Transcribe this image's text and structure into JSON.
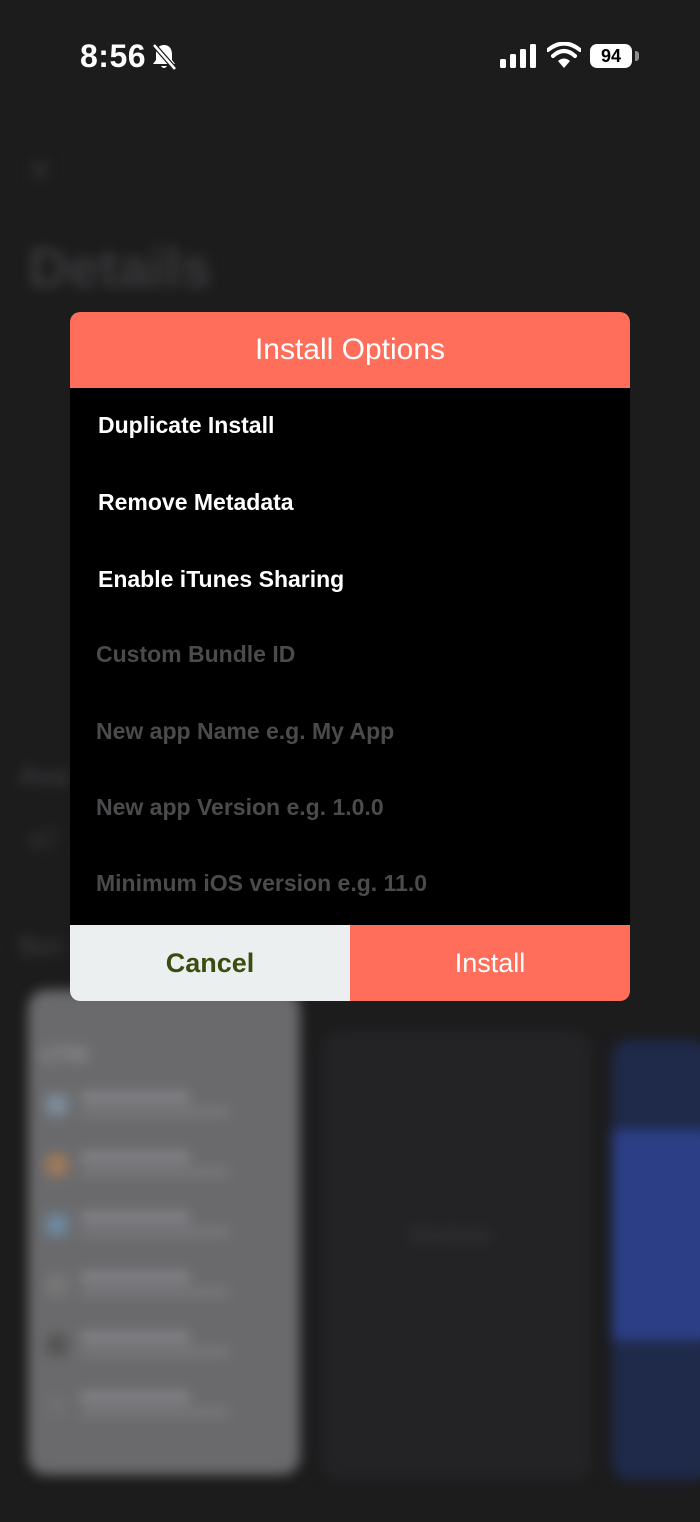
{
  "status_bar": {
    "time": "8:56",
    "battery": "94"
  },
  "background": {
    "back_glyph": "×",
    "title": "Details",
    "section_available": "Ava",
    "number": "47",
    "section_screenshots": "Scr",
    "card_title": "UTM",
    "card_windows_text": "Windows"
  },
  "dialog": {
    "title": "Install Options",
    "options": [
      {
        "label": "Duplicate Install"
      },
      {
        "label": "Remove Metadata"
      },
      {
        "label": "Enable iTunes Sharing"
      }
    ],
    "fields": {
      "bundle_id": {
        "placeholder": "Custom Bundle ID",
        "value": ""
      },
      "app_name": {
        "placeholder": "New app Name e.g. My App",
        "value": ""
      },
      "app_version": {
        "placeholder": "New app Version e.g. 1.0.0",
        "value": ""
      },
      "min_ios": {
        "placeholder": "Minimum iOS version e.g. 11.0",
        "value": ""
      }
    },
    "cancel_label": "Cancel",
    "install_label": "Install"
  },
  "colors": {
    "accent": "#fe6e5a",
    "cancel_bg": "#ebeff0",
    "cancel_text": "#394d0f",
    "placeholder": "#4b4b4d",
    "dialog_bg": "#000000"
  },
  "icons": {
    "bell": "bell-slash-icon",
    "signal": "cellular-signal-icon",
    "wifi": "wifi-icon",
    "battery": "battery-icon"
  }
}
